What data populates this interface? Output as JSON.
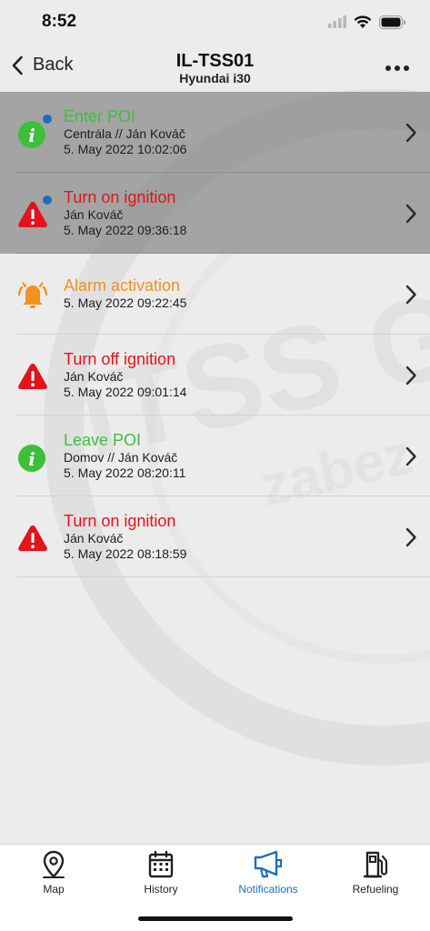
{
  "status_bar": {
    "time": "8:52"
  },
  "nav": {
    "back_label": "Back",
    "title": "IL-TSS01",
    "subtitle": "Hyundai i30"
  },
  "notifications": [
    {
      "title": "Enter POI",
      "detail": "Centrála // Ján Kováč",
      "datetime": "5. May 2022 10:02:06",
      "type": "info",
      "color": "#3dbf3a",
      "unread": true,
      "icon": "info-icon"
    },
    {
      "title": "Turn on ignition",
      "detail": "Ján Kováč",
      "datetime": "5. May 2022 09:36:18",
      "type": "warning",
      "color": "#e3131c",
      "unread": true,
      "icon": "warning-icon"
    },
    {
      "title": "Alarm activation",
      "detail": "",
      "datetime": "5. May 2022 09:22:45",
      "type": "alarm",
      "color": "#f5901d",
      "unread": false,
      "icon": "alarm-bell-icon"
    },
    {
      "title": "Turn off ignition",
      "detail": "Ján Kováč",
      "datetime": "5. May 2022 09:01:14",
      "type": "warning",
      "color": "#e3131c",
      "unread": false,
      "icon": "warning-icon"
    },
    {
      "title": "Leave POI",
      "detail": "Domov // Ján Kováč",
      "datetime": "5. May 2022 08:20:11",
      "type": "info",
      "color": "#3dbf3a",
      "unread": false,
      "icon": "info-icon"
    },
    {
      "title": "Turn on ignition",
      "detail": "Ján Kováč",
      "datetime": "5. May 2022 08:18:59",
      "type": "warning",
      "color": "#e3131c",
      "unread": false,
      "icon": "warning-icon"
    }
  ],
  "tabs": [
    {
      "label": "Map",
      "icon": "map-pin-icon",
      "active": false
    },
    {
      "label": "History",
      "icon": "calendar-icon",
      "active": false
    },
    {
      "label": "Notifications",
      "icon": "megaphone-icon",
      "active": true
    },
    {
      "label": "Refueling",
      "icon": "fuel-pump-icon",
      "active": false
    }
  ],
  "colors": {
    "accent": "#1d70b8",
    "unread_background": "#7a7a7a",
    "unread_dot": "#1d70b8"
  }
}
